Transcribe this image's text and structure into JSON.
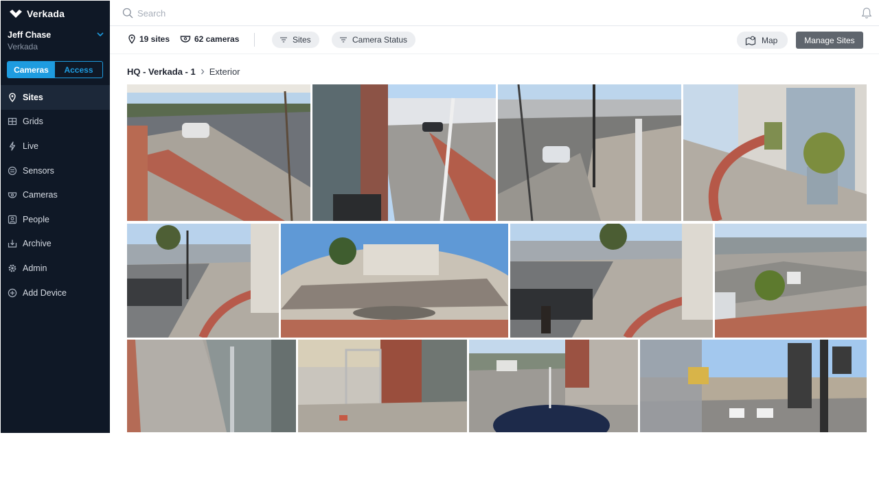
{
  "app": {
    "brand": "Verkada"
  },
  "user": {
    "name": "Jeff Chase",
    "org": "Verkada"
  },
  "mode_toggle": {
    "cameras": "Cameras",
    "access": "Access"
  },
  "nav": [
    {
      "label": "Sites",
      "icon": "location-pin-icon"
    },
    {
      "label": "Grids",
      "icon": "grid-icon"
    },
    {
      "label": "Live",
      "icon": "bolt-icon"
    },
    {
      "label": "Sensors",
      "icon": "sensor-icon"
    },
    {
      "label": "Cameras",
      "icon": "camera-icon"
    },
    {
      "label": "People",
      "icon": "person-icon"
    },
    {
      "label": "Archive",
      "icon": "archive-icon"
    },
    {
      "label": "Admin",
      "icon": "gear-icon"
    },
    {
      "label": "Add Device",
      "icon": "plus-circle-icon"
    }
  ],
  "search": {
    "placeholder": "Search"
  },
  "toolbar": {
    "sites_count": "19 sites",
    "cameras_count": "62 cameras",
    "sites_filter": "Sites",
    "status_filter": "Camera Status",
    "map_label": "Map",
    "manage_label": "Manage Sites"
  },
  "breadcrumb": {
    "site": "HQ - Verkada - 1",
    "current": "Exterior"
  },
  "colors": {
    "accent": "#1e9ce0",
    "sidebar": "#0f1826",
    "sidebar_active": "#1c2839",
    "manage_button": "#5f656d"
  },
  "camera_feeds": [
    {
      "scene": "street-sidewalk-car"
    },
    {
      "scene": "glass-storefront-sidewalk"
    },
    {
      "scene": "rail-crossing-intersection"
    },
    {
      "scene": "building-entrance-plants"
    },
    {
      "scene": "rail-crossing-ramp"
    },
    {
      "scene": "fisheye-railway"
    },
    {
      "scene": "rail-crossing-pedestrian"
    },
    {
      "scene": "corner-planter-street"
    },
    {
      "scene": "sidewalk-glass-door"
    },
    {
      "scene": "gate-brick-wall"
    },
    {
      "scene": "street-parked-car"
    },
    {
      "scene": "intersection-sculpture"
    }
  ]
}
